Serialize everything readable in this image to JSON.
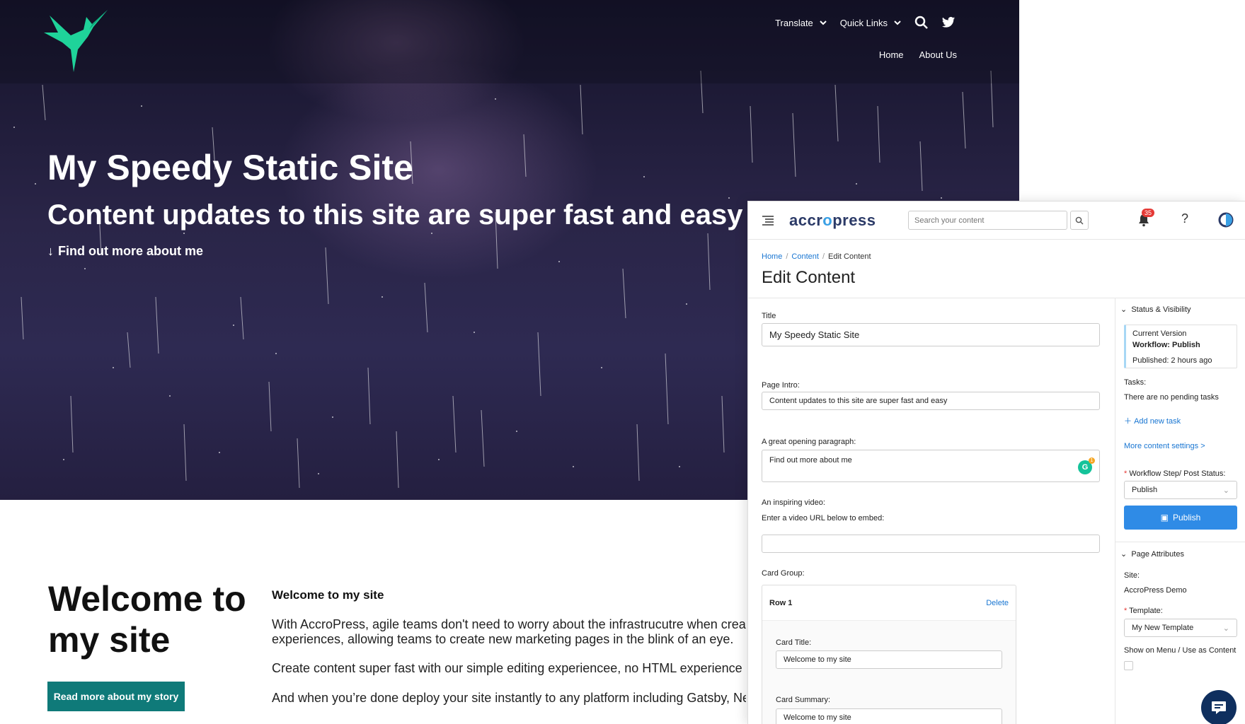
{
  "site": {
    "nav": {
      "translate": "Translate",
      "quick_links": "Quick Links",
      "home": "Home",
      "about": "About Us"
    },
    "hero": {
      "title": "My Speedy Static Site",
      "subtitle": "Content updates to this site are super fast and easy",
      "cta": "Find out more about me",
      "cta_arrow": "↓"
    },
    "welcome": {
      "heading": "Welcome to my site",
      "button": "Read more about my story",
      "section_title": "Welcome to my site",
      "paragraphs": [
        "With AccroPress, agile teams don't need to worry about the infrastrucutre when creat",
        "experiences, allowing teams to create new marketing pages in the blink of an eye.",
        "Create content super fast with our simple editing experienceе, no HTML experience r",
        "And when you’re done deploy your site instantly to any platform including Gatsby, Ne"
      ]
    },
    "colors": {
      "brand_green": "#1fd39a",
      "button_teal": "#0f7a79"
    }
  },
  "cms": {
    "brand": {
      "prefix": "accr",
      "o": "o",
      "suffix": "press"
    },
    "search_placeholder": "Search your content",
    "notification_count": "35",
    "help": "?",
    "breadcrumb": {
      "home": "Home",
      "content": "Content",
      "current": "Edit Content",
      "sep": "/"
    },
    "page_title": "Edit Content",
    "form": {
      "title_label": "Title",
      "title_value": "My Speedy Static Site",
      "intro_label": "Page Intro",
      "intro_value": "Content updates to this site are super fast and easy",
      "para_label": "A great opening paragraph",
      "para_value": "Find out more about me",
      "grammarly": "G",
      "grammarly_count": "1",
      "video_label": "An inspiring video",
      "video_hint": "Enter a video URL below to embed:",
      "cardgroup_label": "Card Group",
      "row_label": "Row 1",
      "delete": "Delete",
      "card_title_label": "Card Title",
      "card_title_value": "Welcome to my site",
      "card_summary_label": "Card Summary",
      "card_summary_value": "Welcome to my site"
    },
    "sidebar": {
      "status_heading": "Status & Visibility",
      "current_version": "Current Version",
      "workflow": "Workflow: Publish",
      "published": "Published: 2 hours ago",
      "tasks_label": "Tasks:",
      "tasks_value": "There are no pending tasks",
      "add_task": "Add new task",
      "more_settings": "More content settings",
      "workflow_step_label": "Workflow Step/ Post Status",
      "workflow_step_value": "Publish",
      "publish_button": "Publish",
      "attributes_heading": "Page Attributes",
      "site_label": "Site:",
      "site_value": "AccroPress Demo",
      "template_label": "Template",
      "template_value": "My New Template",
      "show_menu_label": "Show on Menu / Use as Content"
    }
  }
}
